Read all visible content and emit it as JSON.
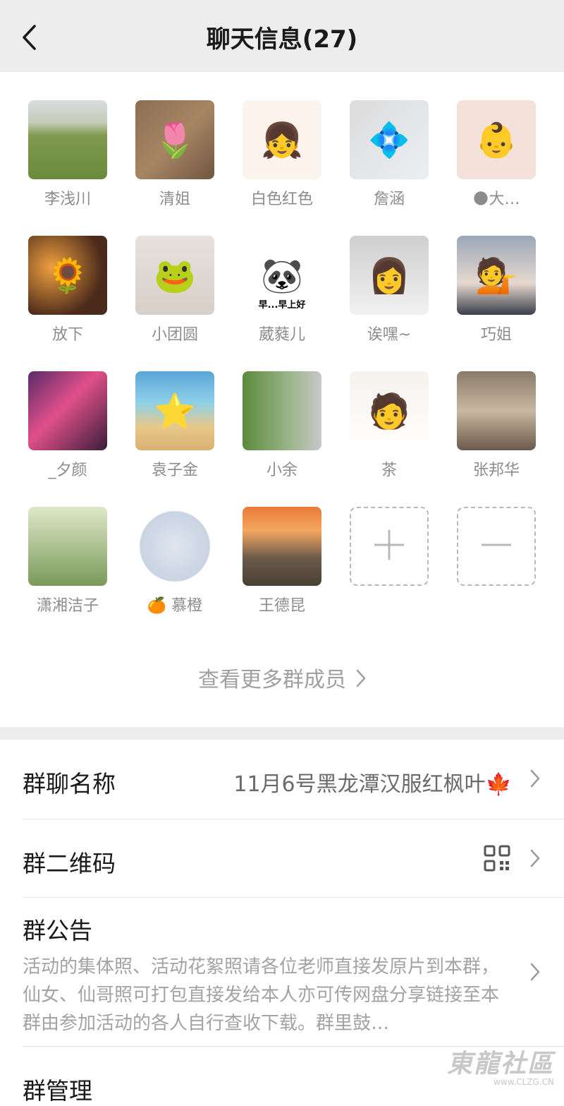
{
  "header": {
    "title": "聊天信息(27)"
  },
  "members": [
    {
      "name": "李浅川",
      "bg": "linear-gradient(180deg,#d9dde0 0%,#c5cbb8 28%,#7f9a4e 45%,#6b8a3c 100%)",
      "emoji": ""
    },
    {
      "name": "清姐",
      "bg": "linear-gradient(135deg,#8a6d52 0%,#a88664 50%,#6f5640 100%)",
      "emoji": "🌷"
    },
    {
      "name": "白色红色",
      "bg": "#fbf3ec",
      "emoji": "👧"
    },
    {
      "name": "詹涵",
      "bg": "linear-gradient(135deg,#dcdcdc 0%,#eceef2 100%)",
      "emoji": "💠"
    },
    {
      "name": "🌑大…",
      "bg": "#f3e1da",
      "emoji": "👶"
    },
    {
      "name": "放下",
      "bg": "radial-gradient(circle at 30% 40%,#f0a040 0%,#4a2a1a 70%)",
      "emoji": "🌻"
    },
    {
      "name": "小团圆",
      "bg": "linear-gradient(180deg,#e8e0dc 0%,#d8cfc8 100%)",
      "emoji": "🐸"
    },
    {
      "name": "葳蕤儿",
      "bg": "#ffffff",
      "emoji": "🐼",
      "caption": "早...早上好"
    },
    {
      "name": "诶嘿~",
      "bg": "linear-gradient(180deg,#cfcfcf 0%,#f1f1f1 100%)",
      "emoji": "👩"
    },
    {
      "name": "巧姐",
      "bg": "linear-gradient(180deg,#9aa7b8 0%,#e6d8cf 60%,#3a3f4a 100%)",
      "emoji": "💁"
    },
    {
      "name": "_夕颜",
      "bg": "linear-gradient(135deg,#5a2a6a 0%,#e0508a 45%,#3a1e3a 100%)",
      "emoji": ""
    },
    {
      "name": "袁子金",
      "bg": "linear-gradient(180deg,#5aa6d8 0%,#8fd0e8 40%,#e6c98a 70%,#d8b070 100%)",
      "emoji": "⭐"
    },
    {
      "name": "小余",
      "bg": "linear-gradient(90deg,#5c8a3c 0%,#9bb58a 60%,#c8c8c8 100%)",
      "emoji": ""
    },
    {
      "name": "茶",
      "bg": "linear-gradient(180deg,#f6f2ee 0%,#ffffff 100%)",
      "emoji": "🧑"
    },
    {
      "name": "张邦华",
      "bg": "linear-gradient(180deg,#8a7a6a 0%,#c8b8a0 50%,#6a5a4a 100%)",
      "emoji": ""
    },
    {
      "name": "潇湘洁子",
      "bg": "linear-gradient(180deg,#dfe8c8 0%,#7a9a5a 100%)",
      "emoji": ""
    },
    {
      "name": "🍊 慕橙",
      "bg": "radial-gradient(circle,#dfe6ef 0%,#c9d4e2 62%,#ffffff 64%)",
      "emoji": ""
    },
    {
      "name": "王德昆",
      "bg": "linear-gradient(180deg,#e87a3a 0%,#f4a860 30%,#6a5a4a 65%,#4a3e34 100%)",
      "emoji": ""
    }
  ],
  "see_more": {
    "label": "查看更多群成员"
  },
  "settings": {
    "group_name": {
      "label": "群聊名称",
      "value": "11月6号黑龙潭汉服红枫叶🍁"
    },
    "qr_code": {
      "label": "群二维码"
    },
    "announcement": {
      "label": "群公告",
      "text": "活动的集体照、活动花絮照请各位老师直接发原片到本群，仙女、仙哥照可打包直接发给本人亦可传网盘分享链接至本群由参加活动的各人自行查收下载。群里鼓…"
    },
    "management": {
      "label": "群管理"
    }
  },
  "watermark": {
    "main": "東龍社區",
    "url": "www.CLZG.CN"
  }
}
